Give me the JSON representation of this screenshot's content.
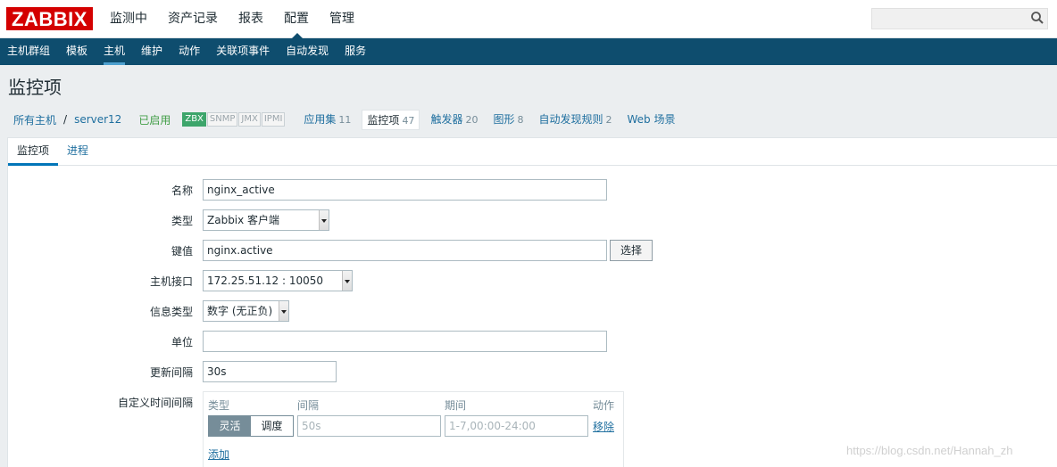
{
  "logo": "ZABBIX",
  "top_menu": [
    "监测中",
    "资产记录",
    "报表",
    "配置",
    "管理"
  ],
  "top_menu_active": 3,
  "search": {
    "value": ""
  },
  "sub_menu": [
    "主机群组",
    "模板",
    "主机",
    "维护",
    "动作",
    "关联项事件",
    "自动发现",
    "服务"
  ],
  "sub_menu_active": 2,
  "page_title": "监控项",
  "breadcrumb": {
    "all_hosts": "所有主机",
    "separator": "/",
    "host": "server12",
    "status": "已启用",
    "interfaces": [
      "ZBX",
      "SNMP",
      "JMX",
      "IPMI"
    ]
  },
  "host_tabs": [
    {
      "label": "应用集",
      "count": "11"
    },
    {
      "label": "监控项",
      "count": "47"
    },
    {
      "label": "触发器",
      "count": "20"
    },
    {
      "label": "图形",
      "count": "8"
    },
    {
      "label": "自动发现规则",
      "count": "2"
    },
    {
      "label": "Web 场景",
      "count": ""
    }
  ],
  "form_tabs": [
    "监控项",
    "进程"
  ],
  "form": {
    "name_label": "名称",
    "name_value": "nginx_active",
    "type_label": "类型",
    "type_value": "Zabbix 客户端",
    "key_label": "键值",
    "key_value": "nginx.active",
    "select_button": "选择",
    "interface_label": "主机接口",
    "interface_value": "172.25.51.12 : 10050",
    "info_type_label": "信息类型",
    "info_type_value": "数字 (无正负)",
    "unit_label": "单位",
    "unit_value": "",
    "interval_label": "更新间隔",
    "interval_value": "30s",
    "custom_label": "自定义时间间隔"
  },
  "schedule": {
    "col_type": "类型",
    "col_interval": "间隔",
    "col_period": "期间",
    "col_action": "动作",
    "mode_flexible": "灵活",
    "mode_scheduling": "调度",
    "interval_placeholder": "50s",
    "period_placeholder": "1-7,00:00-24:00",
    "remove_link": "移除",
    "add_link": "添加"
  },
  "watermark": "https://blog.csdn.net/Hannah_zh"
}
